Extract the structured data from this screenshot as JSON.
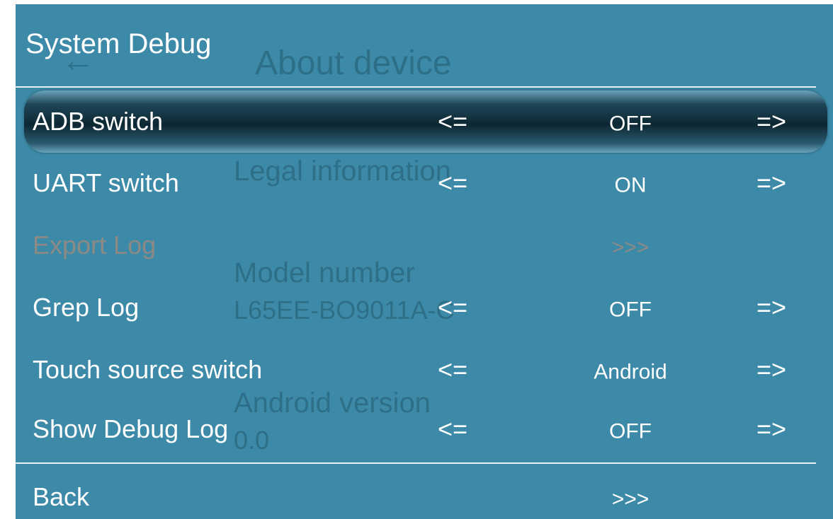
{
  "background_page": {
    "back_arrow": "←",
    "title": "About device",
    "items": [
      "Legal information",
      "Model number",
      "L65EE-BO9011A-C",
      "Android version",
      "0.0"
    ]
  },
  "header": {
    "title": "System Debug"
  },
  "arrows": {
    "left": "<=",
    "right": "=>"
  },
  "rows": [
    {
      "label": "ADB switch",
      "value": "OFF"
    },
    {
      "label": "UART switch",
      "value": "ON"
    },
    {
      "label": "Export Log",
      "value": ">>>"
    },
    {
      "label": "Grep Log",
      "value": "OFF"
    },
    {
      "label": "Touch source switch",
      "value": "Android"
    },
    {
      "label": "Show Debug Log",
      "value": "OFF"
    }
  ],
  "back": {
    "label": "Back",
    "value": ">>>"
  },
  "colors": {
    "panel": "#3d8aa8",
    "text": "#ffffff",
    "disabled_text": "#8d8a86",
    "background_text": "#2e6f88"
  }
}
